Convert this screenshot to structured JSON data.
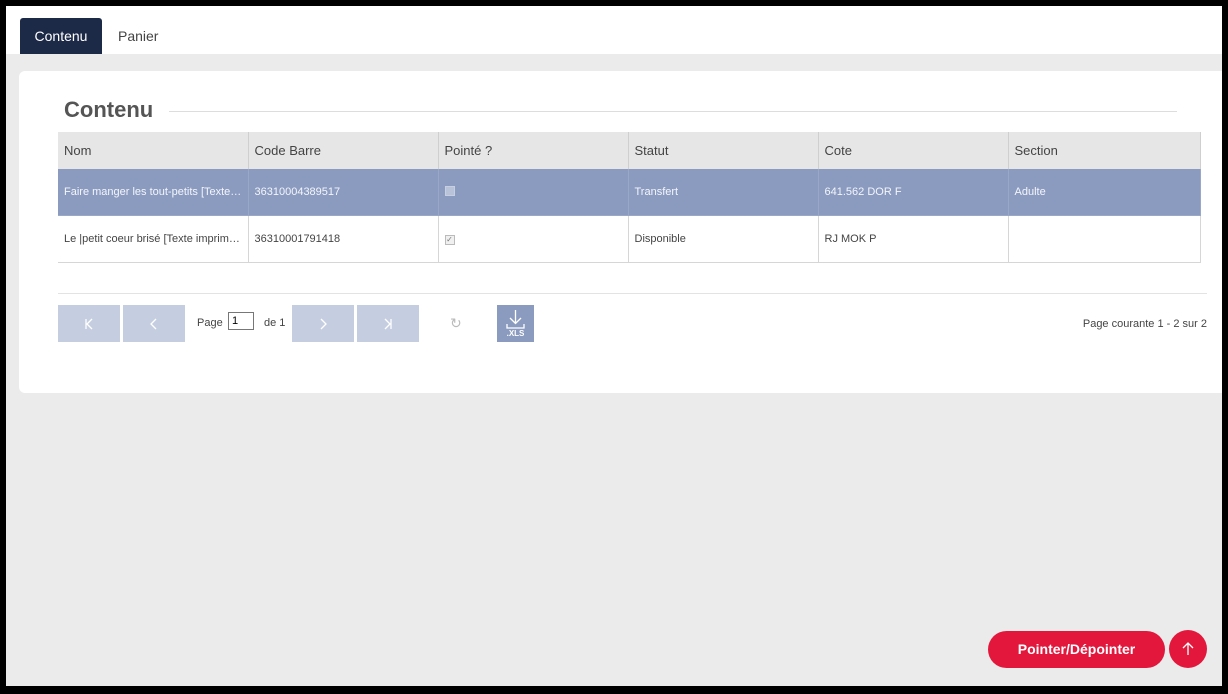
{
  "tabs": [
    {
      "label": "Contenu",
      "active": true
    },
    {
      "label": "Panier",
      "active": false
    }
  ],
  "section_title": "Contenu",
  "table": {
    "columns": [
      "Nom",
      "Code Barre",
      "Pointé ?",
      "Statut",
      "Cote",
      "Section"
    ],
    "rows": [
      {
        "nom": "Faire manger les tout-petits [Texte imprimé]",
        "code_barre": "36310004389517",
        "pointe": false,
        "statut": "Transfert",
        "cote": "641.562 DOR F",
        "section": "Adulte",
        "selected": true
      },
      {
        "nom": "Le |petit coeur brisé [Texte imprimé] / ...",
        "code_barre": "36310001791418",
        "pointe": true,
        "statut": "Disponible",
        "cote": "RJ MOK P",
        "section": "",
        "selected": false
      }
    ]
  },
  "pager": {
    "page_label": "Page",
    "page_value": "1",
    "of_label": "de 1",
    "info": "Page courante 1 - 2 sur 2",
    "export_label": ".XLS"
  },
  "actions": {
    "pointer_label": "Pointer/Dépointer"
  },
  "colors": {
    "nav_active": "#1c2a47",
    "row_selected": "#8b9bc0",
    "accent": "#e3173c"
  }
}
